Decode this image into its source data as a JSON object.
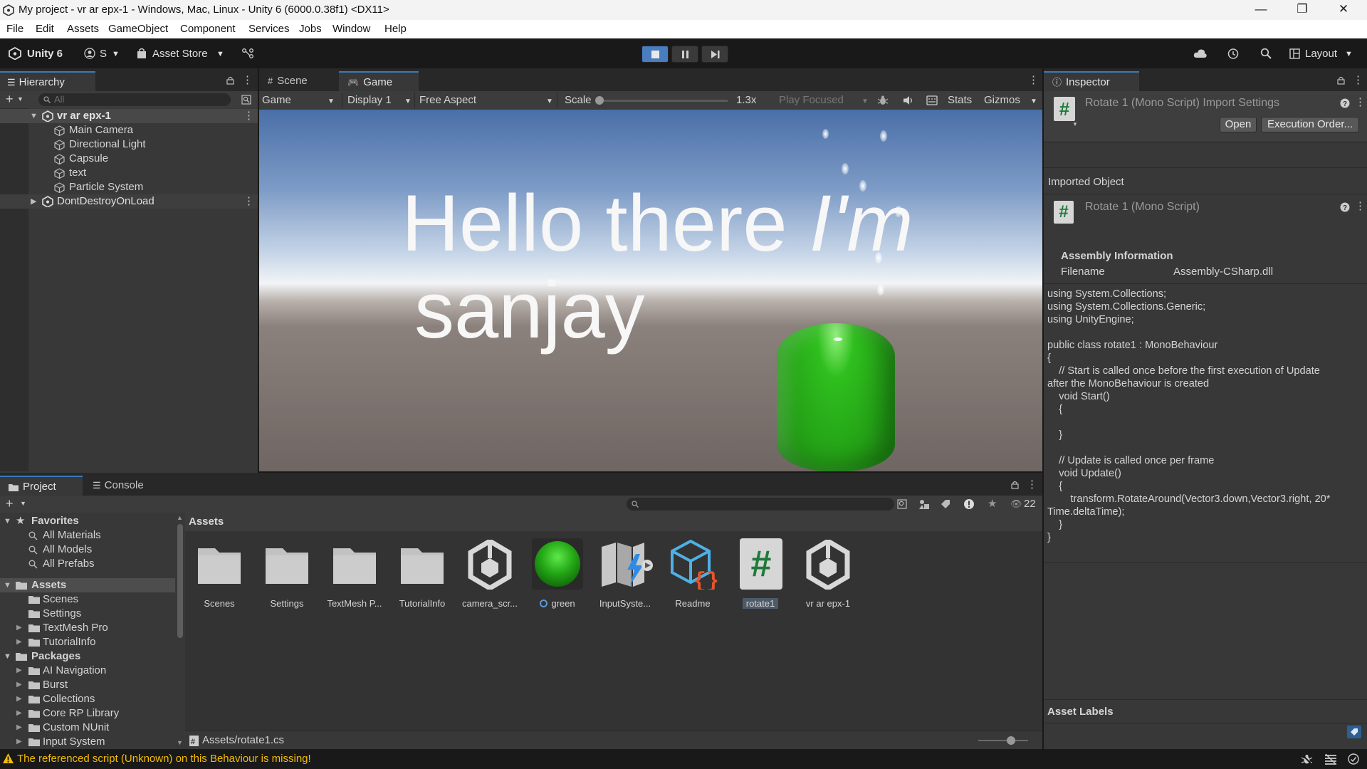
{
  "window": {
    "title": "My project - vr ar epx-1 - Windows, Mac, Linux - Unity 6 (6000.0.38f1) <DX11>",
    "controls": [
      "—",
      "❐",
      "✕"
    ]
  },
  "menubar": {
    "items": [
      "File",
      "Edit",
      "Assets",
      "GameObject",
      "Component",
      "Services",
      "Jobs",
      "Window",
      "Help"
    ]
  },
  "toolbar": {
    "unity_label": "Unity 6",
    "account_label": "S",
    "asset_store_label": "Asset Store",
    "layout_label": "Layout"
  },
  "hierarchy": {
    "tab_label": "Hierarchy",
    "search_placeholder": "All",
    "scene_name": "vr ar epx-1",
    "objects": [
      "Main Camera",
      "Directional Light",
      "Capsule",
      "text",
      "Particle System"
    ],
    "ddol_label": "DontDestroyOnLoad"
  },
  "game": {
    "tab_scene": "Scene",
    "tab_game": "Game",
    "view_mode": "Game",
    "display": "Display 1",
    "aspect": "Free Aspect",
    "scale_label": "Scale",
    "scale_value": "1.3x",
    "scale_fraction": 0.0,
    "play_focused": "Play Focused",
    "stats_label": "Stats",
    "gizmos_label": "Gizmos",
    "text_line1": "Hello there",
    "text_line1_italic": "I'm",
    "text_line2": "sanjay",
    "sky_top": "#4a6fa8",
    "ground_color": "#6f6663",
    "capsule_color": "#2fbf1e"
  },
  "project": {
    "tab_project": "Project",
    "tab_console": "Console",
    "hidden_count": "22",
    "favorites_label": "Favorites",
    "favorites": [
      "All Materials",
      "All Models",
      "All Prefabs"
    ],
    "assets_label": "Assets",
    "asset_folders": [
      "Scenes",
      "Settings",
      "TextMesh Pro",
      "TutorialInfo"
    ],
    "packages_label": "Packages",
    "packages": [
      "AI Navigation",
      "Burst",
      "Collections",
      "Core RP Library",
      "Custom NUnit",
      "Input System"
    ],
    "breadcrumb": "Assets",
    "grid": [
      {
        "label": "Scenes",
        "icon": "folder-icon"
      },
      {
        "label": "Settings",
        "icon": "folder-icon"
      },
      {
        "label": "TextMesh P...",
        "icon": "folder-icon"
      },
      {
        "label": "TutorialInfo",
        "icon": "folder-icon"
      },
      {
        "label": "camera_scr...",
        "icon": "unity-scene-icon"
      },
      {
        "label": "green",
        "icon": "material-sphere-icon"
      },
      {
        "label": "InputSyste...",
        "icon": "input-system-icon"
      },
      {
        "label": "Readme",
        "icon": "readme-icon"
      },
      {
        "label": "rotate1",
        "icon": "script-icon"
      },
      {
        "label": "vr ar epx-1",
        "icon": "unity-scene-icon"
      }
    ],
    "path": "Assets/rotate1.cs",
    "zoom_fraction": 0.65
  },
  "inspector": {
    "tab_label": "Inspector",
    "header_title": "Rotate 1 (Mono Script) Import Settings",
    "open_button": "Open",
    "execution_order_button": "Execution Order...",
    "imported_object_label": "Imported Object",
    "imported_object_name": "Rotate 1 (Mono Script)",
    "assembly_info_label": "Assembly Information",
    "filename_label": "Filename",
    "filename_value": "Assembly-CSharp.dll",
    "code": "using System.Collections;\nusing System.Collections.Generic;\nusing UnityEngine;\n\npublic class rotate1 : MonoBehaviour\n{\n    // Start is called once before the first execution of Update\nafter the MonoBehaviour is created\n    void Start()\n    {\n\n    }\n\n    // Update is called once per frame\n    void Update()\n    {\n        transform.RotateAround(Vector3.down,Vector3.right, 20*\nTime.deltaTime);\n    }\n}",
    "asset_labels_label": "Asset Labels"
  },
  "statusbar": {
    "warning": "The referenced script (Unknown) on this Behaviour is missing!",
    "warning_color": "#f4bc02"
  }
}
